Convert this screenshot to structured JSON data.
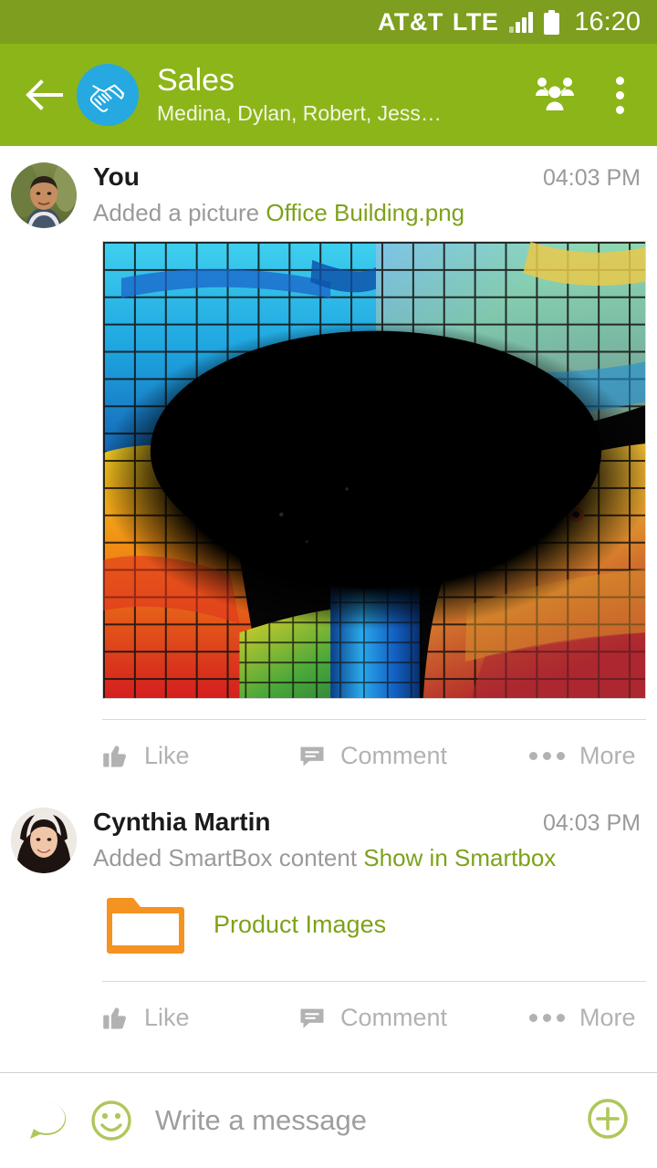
{
  "status_bar": {
    "carrier": "AT&T",
    "network": "LTE",
    "time": "16:20",
    "signal_icon": "signal-bars-icon",
    "battery_icon": "battery-full-icon",
    "background": "#7d9e1e"
  },
  "app_bar": {
    "back_icon": "back-arrow-icon",
    "group_avatar_icon": "handshake-icon",
    "group_avatar_bg": "#25a9e0",
    "title": "Sales",
    "subtitle": "Medina, Dylan, Robert, Jess…",
    "members_icon": "people-group-icon",
    "overflow_icon": "more-vertical-icon",
    "background": "#8cb519"
  },
  "colors": {
    "accent_green": "#7da21a",
    "muted_text": "#9a9a9a",
    "action_text": "#b2b2b2",
    "folder_orange": "#f59322",
    "composer_green": "#aec75a"
  },
  "posts": [
    {
      "author": "You",
      "time": "04:03 PM",
      "avatar_name": "avatar-you",
      "body_prefix": "Added a picture ",
      "body_link": "Office Building.png",
      "attachment_type": "image",
      "image_alt": "Stained glass dome interior",
      "actions": {
        "like": "Like",
        "comment": "Comment",
        "more": "More",
        "like_icon": "thumbs-up-icon",
        "comment_icon": "speech-bubble-icon",
        "more_icon": "ellipsis-icon"
      }
    },
    {
      "author": "Cynthia Martin",
      "time": "04:03 PM",
      "avatar_name": "avatar-cynthia-martin",
      "body_prefix": "Added SmartBox content ",
      "body_link": "Show in Smartbox",
      "attachment_type": "folder",
      "folder_label": "Product Images",
      "folder_icon": "folder-icon",
      "actions": {
        "like": "Like",
        "comment": "Comment",
        "more": "More",
        "like_icon": "thumbs-up-icon",
        "comment_icon": "speech-bubble-icon",
        "more_icon": "ellipsis-icon"
      }
    }
  ],
  "composer": {
    "quick_reply_icon": "chat-bubble-lines-icon",
    "emoji_icon": "smiley-icon",
    "placeholder": "Write a message",
    "value": "",
    "add_icon": "plus-circle-icon"
  }
}
